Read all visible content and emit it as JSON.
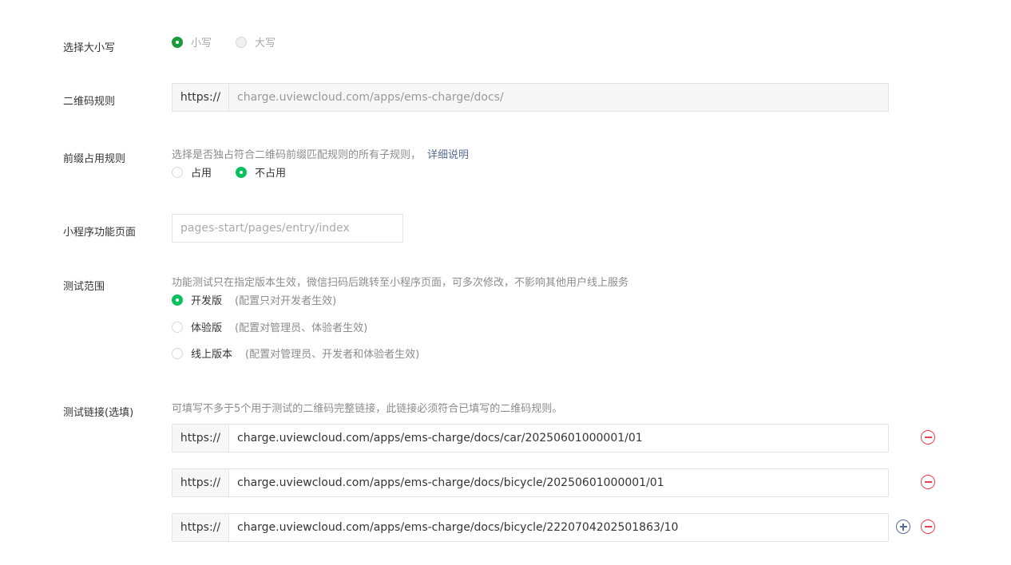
{
  "case_select": {
    "label": "选择大小写",
    "options": [
      {
        "label": "小写",
        "selected": true
      },
      {
        "label": "大写",
        "selected": false
      }
    ]
  },
  "qr_rule": {
    "label": "二维码规则",
    "prefix": "https://",
    "value": "charge.uviewcloud.com/apps/ems-charge/docs/"
  },
  "prefix_rule": {
    "label": "前缀占用规则",
    "hint": "选择是否独占符合二维码前缀匹配规则的所有子规则，",
    "detail_link": "详细说明",
    "options": [
      {
        "label": "占用",
        "selected": false
      },
      {
        "label": "不占用",
        "selected": true
      }
    ]
  },
  "miniprogram_page": {
    "label": "小程序功能页面",
    "placeholder": "pages-start/pages/entry/index"
  },
  "test_scope": {
    "label": "测试范围",
    "hint": "功能测试只在指定版本生效，微信扫码后跳转至小程序页面，可多次修改，不影响其他用户线上服务",
    "options": [
      {
        "label": "开发版",
        "note": "(配置只对开发者生效)",
        "selected": true
      },
      {
        "label": "体验版",
        "note": "(配置对管理员、体验者生效)",
        "selected": false
      },
      {
        "label": "线上版本",
        "note": "(配置对管理员、开发者和体验者生效)",
        "selected": false
      }
    ]
  },
  "test_links": {
    "label": "测试链接(选填)",
    "hint": "可填写不多于5个用于测试的二维码完整链接，此链接必须符合已填写的二维码规则。",
    "prefix": "https://",
    "items": [
      "charge.uviewcloud.com/apps/ems-charge/docs/car/20250601000001/01",
      "charge.uviewcloud.com/apps/ems-charge/docs/bicycle/20250601000001/01",
      "charge.uviewcloud.com/apps/ems-charge/docs/bicycle/2220704202501863/10"
    ]
  }
}
